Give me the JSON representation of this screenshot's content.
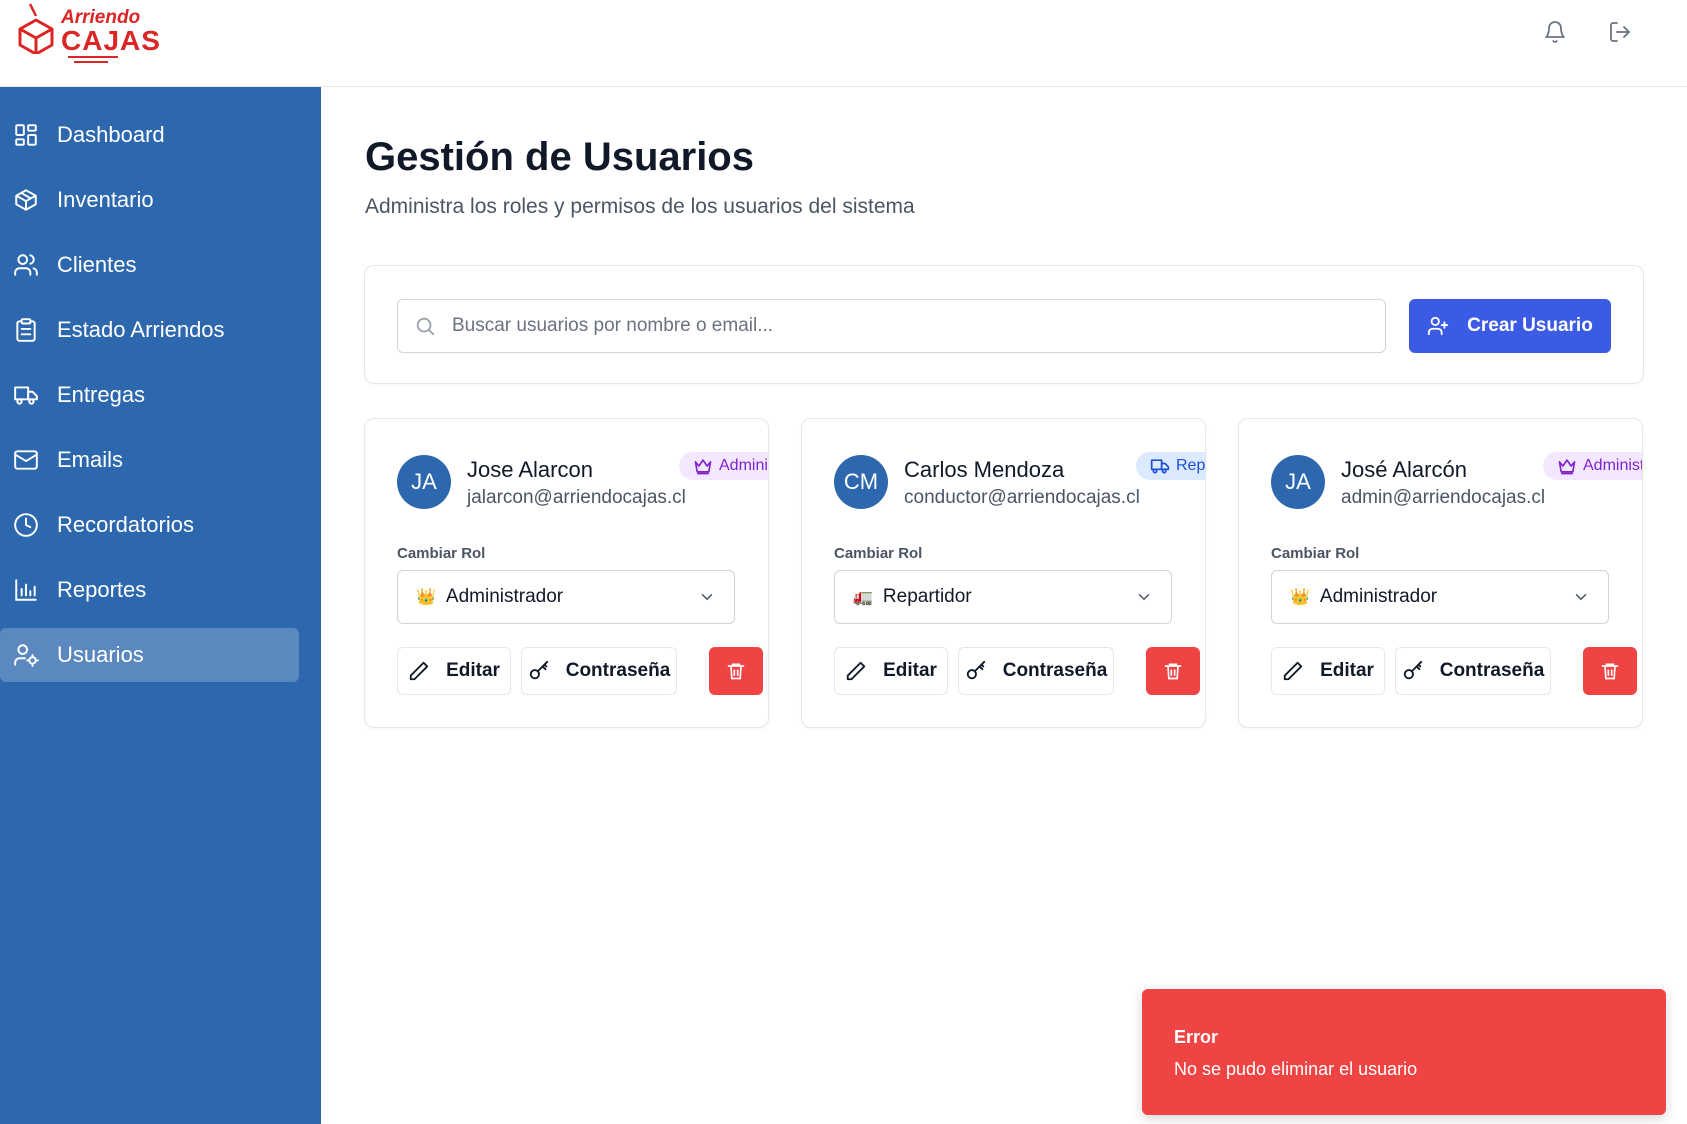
{
  "brand": {
    "line1": "Arriendo",
    "line2": "CAJAS",
    "color": "#dc2626"
  },
  "topbar": {
    "notifications_icon": "bell-icon",
    "logout_icon": "logout-icon"
  },
  "sidebar": {
    "bg": "#2d68ae",
    "items": [
      {
        "label": "Dashboard",
        "icon": "dashboard-icon",
        "active": false
      },
      {
        "label": "Inventario",
        "icon": "box-icon",
        "active": false
      },
      {
        "label": "Clientes",
        "icon": "users-icon",
        "active": false
      },
      {
        "label": "Estado Arriendos",
        "icon": "clipboard-icon",
        "active": false
      },
      {
        "label": "Entregas",
        "icon": "truck-icon",
        "active": false
      },
      {
        "label": "Emails",
        "icon": "mail-icon",
        "active": false
      },
      {
        "label": "Recordatorios",
        "icon": "clock-icon",
        "active": false
      },
      {
        "label": "Reportes",
        "icon": "bar-chart-icon",
        "active": false
      },
      {
        "label": "Usuarios",
        "icon": "user-cog-icon",
        "active": true
      }
    ]
  },
  "main": {
    "title": "Gestión de Usuarios",
    "subtitle": "Administra los roles y permisos de los usuarios del sistema",
    "search": {
      "placeholder": "Buscar usuarios por nombre o email...",
      "value": ""
    },
    "create_label": "Crear Usuario",
    "accent": "#3b5be5"
  },
  "users": [
    {
      "initials": "JA",
      "name": "Jose Alarcon",
      "email": "jalarcon@arriendocajas.cl",
      "badge": "Administrador",
      "badge_type": "admin",
      "role_label": "Cambiar Rol",
      "role": "Administrador",
      "role_emoji": "👑",
      "edit_label": "Editar",
      "password_label": "Contraseña"
    },
    {
      "initials": "CM",
      "name": "Carlos Mendoza",
      "email": "conductor@arriendocajas.cl",
      "badge": "Repartidor",
      "badge_type": "driver",
      "role_label": "Cambiar Rol",
      "role": "Repartidor",
      "role_emoji": "🚛",
      "edit_label": "Editar",
      "password_label": "Contraseña"
    },
    {
      "initials": "JA",
      "name": "José Alarcón",
      "email": "admin@arriendocajas.cl",
      "badge": "Administrador",
      "badge_type": "admin",
      "role_label": "Cambiar Rol",
      "role": "Administrador",
      "role_emoji": "👑",
      "edit_label": "Editar",
      "password_label": "Contraseña"
    }
  ],
  "toast": {
    "title": "Error",
    "message": "No se pudo eliminar el usuario",
    "color": "#ef4444"
  }
}
